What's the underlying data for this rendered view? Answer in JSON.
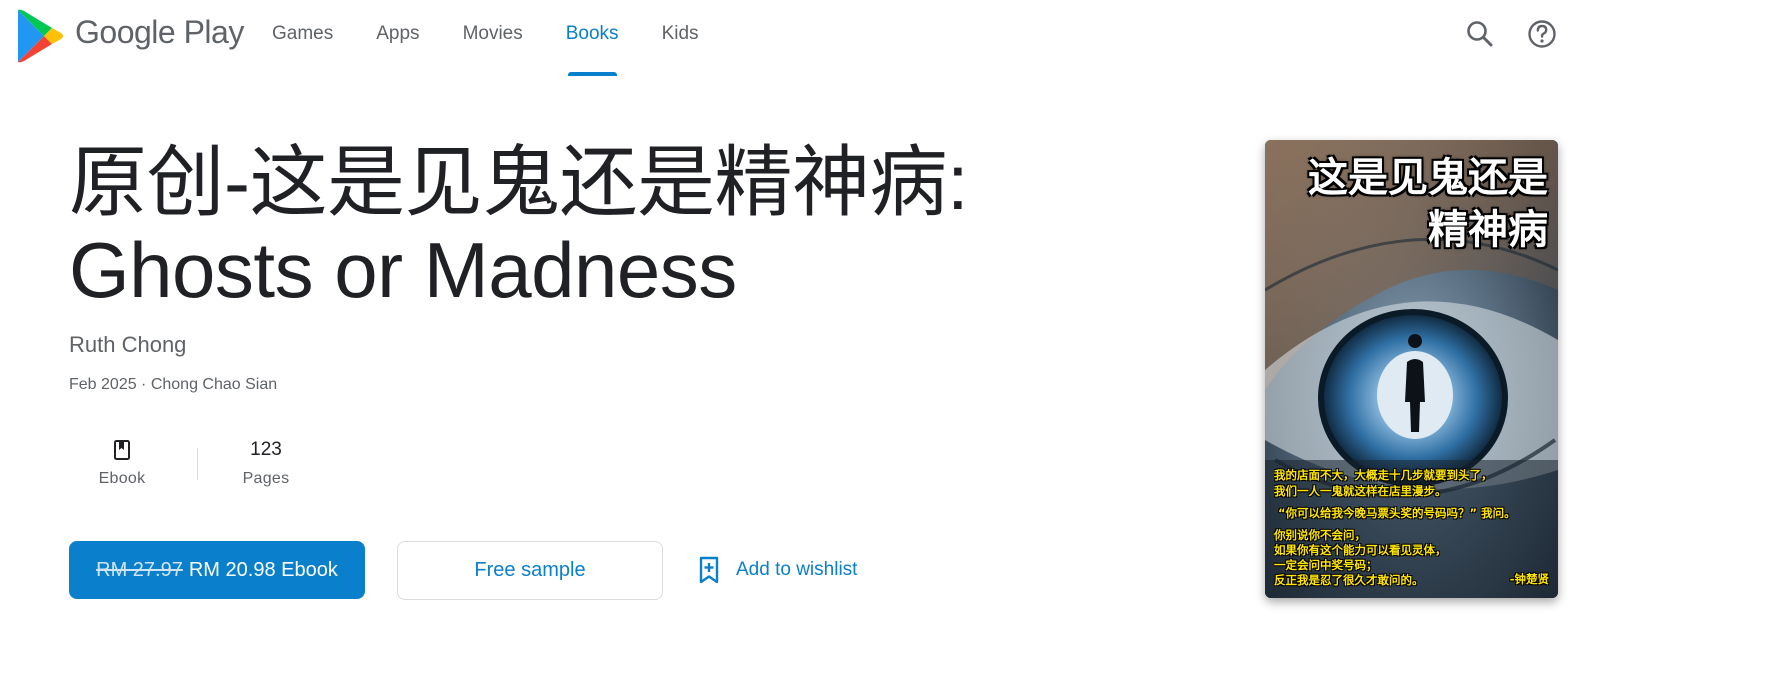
{
  "header": {
    "brand": "Google Play",
    "nav": [
      {
        "label": "Games",
        "active": false
      },
      {
        "label": "Apps",
        "active": false
      },
      {
        "label": "Movies",
        "active": false
      },
      {
        "label": "Books",
        "active": true
      },
      {
        "label": "Kids",
        "active": false
      }
    ],
    "icons": {
      "search": "search-icon",
      "help": "help-icon"
    }
  },
  "book": {
    "title_line1": "原创-这是见鬼还是精神病:",
    "title_line2": "Ghosts or Madness",
    "author": "Ruth Chong",
    "meta": "Feb 2025 · Chong Chao Sian",
    "stats": {
      "format_label": "Ebook",
      "format_icon": "book-icon",
      "pages_value": "123",
      "pages_label": "Pages"
    }
  },
  "actions": {
    "old_price": "RM 27.97",
    "buy_label": "RM 20.98 Ebook",
    "sample_label": "Free sample",
    "wishlist_label": "Add to wishlist",
    "wishlist_icon": "bookmark-add-icon"
  },
  "cover": {
    "title_line1": "这是见鬼还是",
    "title_line2": "精神病",
    "lines": [
      "我的店面不大，大概走十几步就要到头了，",
      "我们一人一鬼就这样在店里漫步。",
      "“你可以给我今晚马票头奖的号码吗？” 我问。",
      "你别说你不会问，",
      "如果你有这个能力可以看见灵体，",
      "一定会问中奖号码；",
      "反正我是忍了很久才敢问的。"
    ],
    "signature": "-钟楚贤"
  },
  "colors": {
    "accent": "#0a7fcb",
    "text_primary": "#202124",
    "text_secondary": "#5f6368",
    "divider": "#dadce0"
  }
}
